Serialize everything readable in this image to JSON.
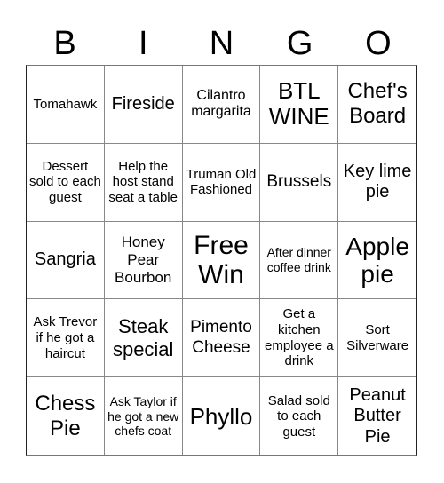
{
  "header": {
    "letters": [
      "B",
      "I",
      "N",
      "G",
      "O"
    ]
  },
  "grid": {
    "cells": [
      "Tomahawk",
      "Fireside",
      "Cilantro margarita",
      "BTL WINE",
      "Chef's Board",
      "Dessert sold to each guest",
      "Help the host stand seat a table",
      "Truman Old Fashioned",
      "Brussels",
      "Key lime pie",
      "Sangria",
      "Honey Pear Bourbon",
      "Free Win",
      "After dinner coffee drink",
      "Apple pie",
      "Ask Trevor if he got a haircut",
      "Steak special",
      "Pimento Cheese",
      "Get a kitchen employee a drink",
      "Sort Silverware",
      "Chess Pie",
      "Ask Taylor if he got a new chefs coat",
      "Phyllo",
      "Salad sold to each guest",
      "Peanut Butter Pie"
    ]
  }
}
